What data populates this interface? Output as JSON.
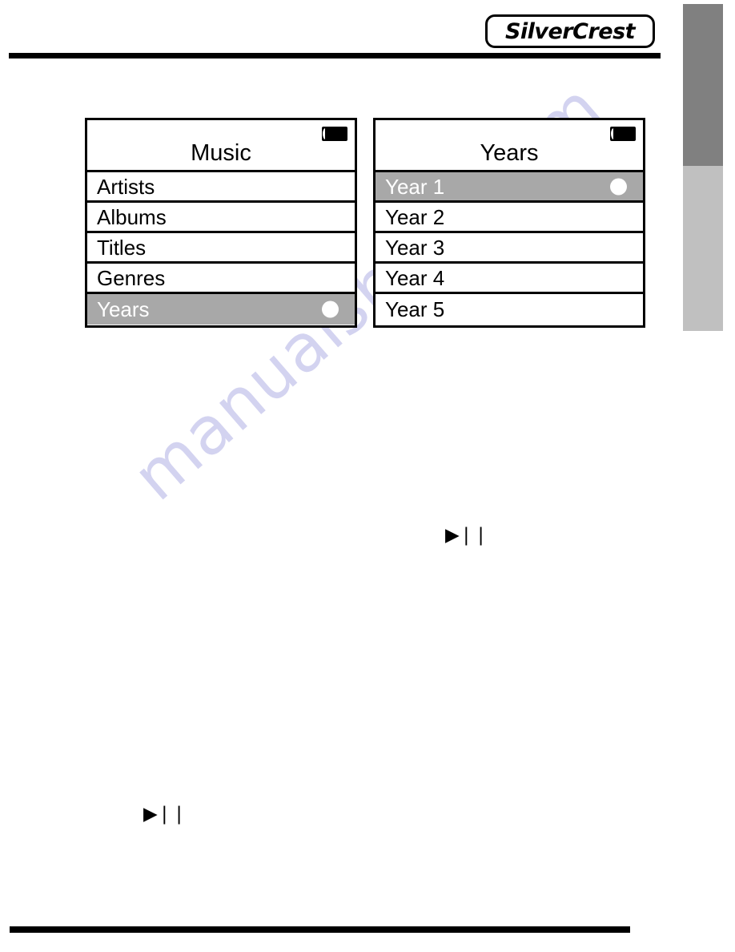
{
  "brand": {
    "logo_text": "SilverCrest",
    "logo_name": "silvercrest-logo"
  },
  "watermark": {
    "text": "manualshive.com"
  },
  "screens": [
    {
      "id": "music",
      "title": "Music",
      "battery_icon": "battery-full-icon",
      "items": [
        {
          "label": "Artists",
          "selected": false
        },
        {
          "label": "Albums",
          "selected": false
        },
        {
          "label": "Titles",
          "selected": false
        },
        {
          "label": "Genres",
          "selected": false
        },
        {
          "label": "Years",
          "selected": true
        }
      ]
    },
    {
      "id": "years",
      "title": "Years",
      "battery_icon": "battery-full-icon",
      "items": [
        {
          "label": "Year 1",
          "selected": true
        },
        {
          "label": "Year 2",
          "selected": false
        },
        {
          "label": "Year 3",
          "selected": false
        },
        {
          "label": "Year 4",
          "selected": false
        },
        {
          "label": "Year 5",
          "selected": false
        }
      ]
    }
  ],
  "glyphs": {
    "play_pause": "▶❘❘",
    "play_pause_name": "play-pause-icon"
  },
  "colors": {
    "selection_gray": "#a8a8a8",
    "edge_tab_dark": "#808080",
    "edge_tab_light": "#c0c0c0",
    "watermark": "#d3d3f0",
    "ink": "#000000",
    "paper": "#ffffff"
  },
  "edge_tabs": [
    {
      "name": "edge-tab-dark",
      "color": "#808080"
    },
    {
      "name": "edge-tab-light",
      "color": "#c0c0c0"
    }
  ]
}
